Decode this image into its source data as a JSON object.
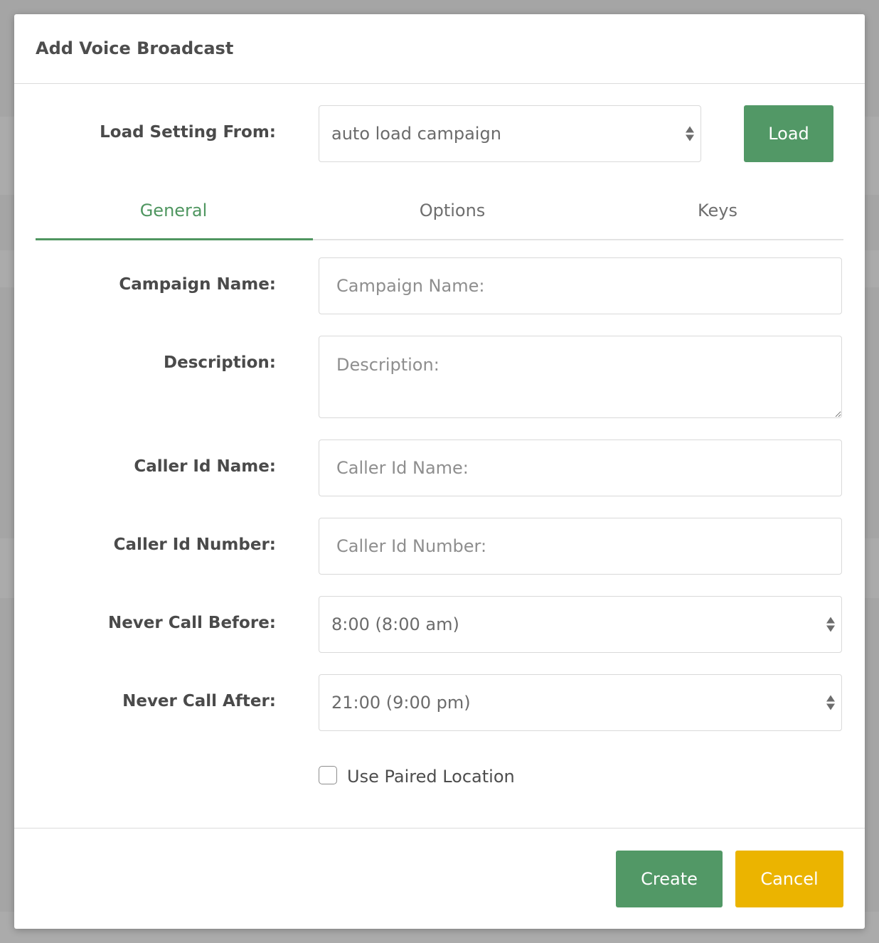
{
  "modal": {
    "title": "Add Voice Broadcast",
    "load_setting": {
      "label": "Load Setting From:",
      "selected": "auto load campaign",
      "button": "Load"
    },
    "tabs": [
      "General",
      "Options",
      "Keys"
    ],
    "active_tab": "General",
    "fields": {
      "campaign_name": {
        "label": "Campaign Name:",
        "placeholder": "Campaign Name:"
      },
      "description": {
        "label": "Description:",
        "placeholder": "Description:"
      },
      "caller_id_name": {
        "label": "Caller Id Name:",
        "placeholder": "Caller Id Name:"
      },
      "caller_id_number": {
        "label": "Caller Id Number:",
        "placeholder": "Caller Id Number:"
      },
      "never_call_before": {
        "label": "Never Call Before:",
        "selected": "8:00 (8:00 am)"
      },
      "never_call_after": {
        "label": "Never Call After:",
        "selected": "21:00 (9:00 pm)"
      }
    },
    "use_paired_location": {
      "label": "Use Paired Location",
      "checked": false
    },
    "footer": {
      "create": "Create",
      "cancel": "Cancel"
    }
  },
  "colors": {
    "accent_green": "#529866",
    "cancel_yellow": "#ebb400",
    "overlay": "#a5a5a5"
  }
}
